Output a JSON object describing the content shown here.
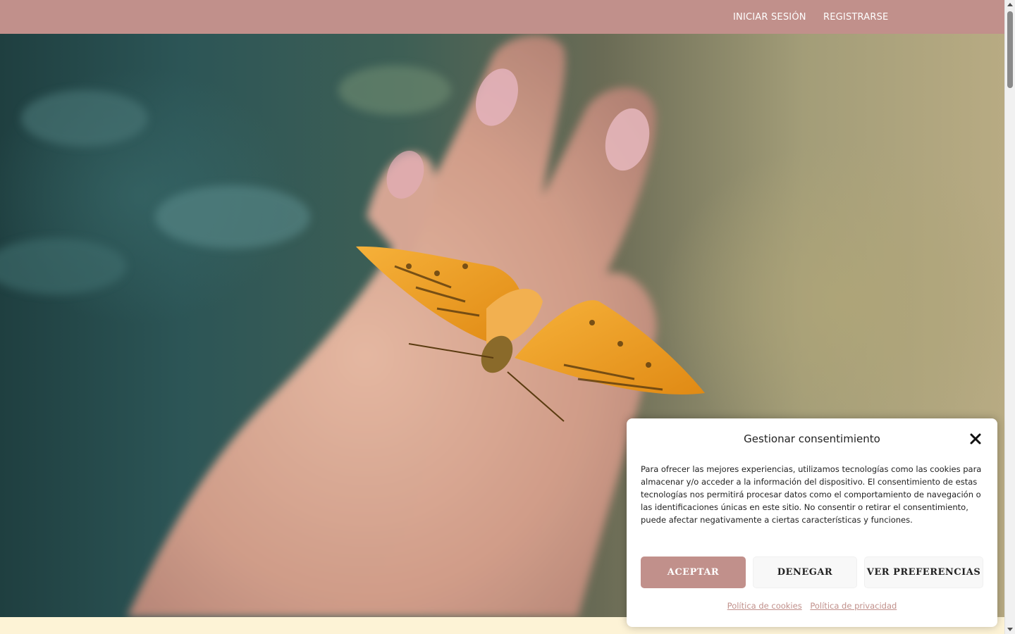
{
  "header": {
    "links": [
      {
        "label": "INICIAR SESIÓN"
      },
      {
        "label": "REGISTRARSE"
      }
    ]
  },
  "colors": {
    "brand": "#c1908b",
    "background": "#fdf3d6",
    "butterfly": "#f0a020"
  },
  "hero": {
    "image": "hand-with-butterfly-photo"
  },
  "consent": {
    "title": "Gestionar consentimiento",
    "body": "Para ofrecer las mejores experiencias, utilizamos tecnologías como las cookies para almacenar y/o acceder a la información del dispositivo. El consentimiento de estas tecnologías nos permitirá procesar datos como el comportamiento de navegación o las identificaciones únicas en este sitio. No consentir o retirar el consentimiento, puede afectar negativamente a ciertas características y funciones.",
    "buttons": {
      "accept": "ACEPTAR",
      "deny": "DENEGAR",
      "preferences": "VER PREFERENCIAS"
    },
    "links": {
      "cookies": "Política de cookies",
      "privacy": "Política de privacidad"
    },
    "close_icon": "close-icon"
  }
}
